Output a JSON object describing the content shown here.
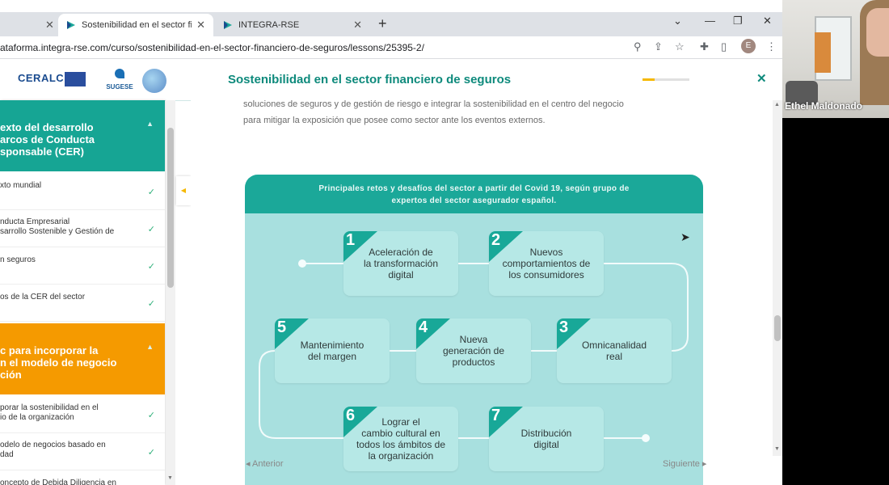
{
  "browser": {
    "tabs": [
      {
        "title": "Sostenibilidad en el sector financiero de seguros",
        "active": true
      },
      {
        "title": "INTEGRA-RSE",
        "active": false
      }
    ],
    "new_tab": "+",
    "url": "ataforma.integra-rse.com/curso/sostenibilidad-en-el-sector-financiero-de-seguros/lessons/25395-2/",
    "profile_initial": "E"
  },
  "header": {
    "title": "Sostenibilidad en el sector financiero de seguros",
    "progress_percent": 25,
    "logos": {
      "ceralc": "CERALC",
      "sugese": "SUGESE"
    }
  },
  "sidebar": {
    "sections": [
      {
        "title_lines": [
          "exto del desarrollo",
          "arcos de Conducta",
          "sponsable (CER)"
        ],
        "color": "#16a594",
        "lessons": [
          {
            "lines": [
              "xto mundial"
            ],
            "completed": true
          },
          {
            "lines": [
              "nducta Empresarial",
              "sarrollo Sostenible y Gestión de"
            ],
            "completed": true
          },
          {
            "lines": [
              "n seguros"
            ],
            "completed": true
          },
          {
            "lines": [
              "os de la CER del sector"
            ],
            "completed": true
          }
        ]
      },
      {
        "title_lines": [
          "c para incorporar la",
          "n el modelo de negocio",
          "ción"
        ],
        "color": "#f59a00",
        "lessons": [
          {
            "lines": [
              "porar la sostenibilidad en el",
              "io de la organización"
            ],
            "completed": true
          },
          {
            "lines": [
              "odelo de negocios basado en",
              "dad"
            ],
            "completed": true
          },
          {
            "lines": [
              "oncepto de Debida Diligencia en"
            ],
            "completed": false
          }
        ]
      }
    ]
  },
  "main": {
    "intro_lines": [
      "soluciones de seguros y de gestión de riesgo e integrar la sostenibilidad en el centro del negocio",
      "para mitigar la exposición que posee como sector ante los eventos externos."
    ],
    "infographic": {
      "title_lines": [
        "Principales retos y desafíos del sector a partir del Covid 19, según grupo de",
        "expertos del sector asegurador español."
      ],
      "items": [
        {
          "number": "1",
          "lines": [
            "Aceleración de",
            "la transformación",
            "digital"
          ]
        },
        {
          "number": "2",
          "lines": [
            "Nuevos",
            "comportamientos de",
            "los consumidores"
          ]
        },
        {
          "number": "3",
          "lines": [
            "Omnicanalidad",
            "real"
          ]
        },
        {
          "number": "4",
          "lines": [
            "Nueva",
            "generación de",
            "productos"
          ]
        },
        {
          "number": "5",
          "lines": [
            "Mantenimiento",
            "del margen"
          ]
        },
        {
          "number": "6",
          "lines": [
            "Lograr el",
            "cambio cultural en",
            "todos los ámbitos de",
            "la organización"
          ]
        },
        {
          "number": "7",
          "lines": [
            "Distribución",
            "digital"
          ]
        }
      ],
      "colors": {
        "background": "#a8e0df",
        "header": "#1ba899",
        "card": "#b6e8e6",
        "accent": "#18a898"
      }
    },
    "nav": {
      "prev": "Anterior",
      "next": "Siguiente"
    }
  },
  "video": {
    "participant_name": "Ethel Maldonado"
  }
}
